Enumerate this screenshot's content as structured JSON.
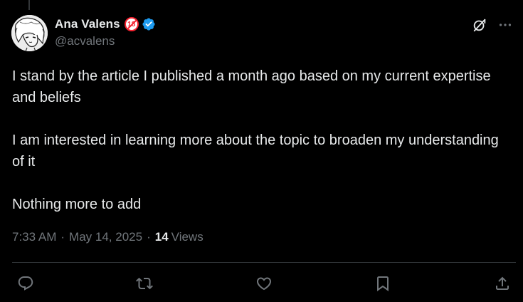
{
  "author": {
    "display_name": "Ana Valens",
    "handle": "@acvalens",
    "badge_emoji": "18",
    "verified": true
  },
  "tweet": {
    "paragraphs": [
      "I stand by the article I published a month ago based on my current expertise and beliefs",
      "I am interested in learning more about the topic to broaden my understanding of it",
      "Nothing more to add"
    ]
  },
  "meta": {
    "time": "7:33 AM",
    "separator": "·",
    "date": "May 14, 2025",
    "views_count": "14",
    "views_label": "Views"
  },
  "actions": [
    "reply-icon",
    "retweet-icon",
    "like-icon",
    "bookmark-icon",
    "share-icon"
  ],
  "top_actions": [
    "grok-icon",
    "more-icon"
  ],
  "colors": {
    "background": "#000000",
    "text_primary": "#e7e9ea",
    "text_secondary": "#71767b",
    "verified": "#1d9bf0",
    "divider": "#2f3336"
  }
}
